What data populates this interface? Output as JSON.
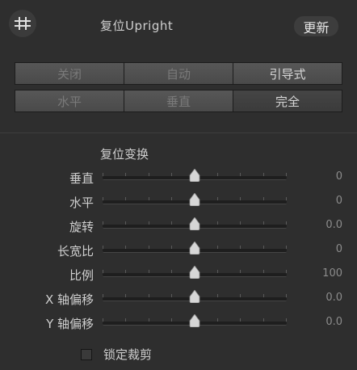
{
  "header": {
    "title": "复位Upright",
    "update_label": "更新",
    "tool_icon": "upright-grid-icon"
  },
  "mode_buttons": {
    "row1": [
      "关闭",
      "自动",
      "引导式"
    ],
    "row2": [
      "水平",
      "垂直",
      "完全"
    ]
  },
  "section": {
    "title": "复位变换"
  },
  "sliders": [
    {
      "label": "垂直",
      "value": "0",
      "position": 0.5
    },
    {
      "label": "水平",
      "value": "0",
      "position": 0.5
    },
    {
      "label": "旋转",
      "value": "0.0",
      "position": 0.5
    },
    {
      "label": "长宽比",
      "value": "0",
      "position": 0.5
    },
    {
      "label": "比例",
      "value": "100",
      "position": 0.5
    },
    {
      "label": "X 轴偏移",
      "value": "0.0",
      "position": 0.5
    },
    {
      "label": "Y 轴偏移",
      "value": "0.0",
      "position": 0.5
    }
  ],
  "lock_crop": {
    "label": "锁定裁剪",
    "checked": false
  },
  "colors": {
    "panel_bg": "#2e2e2e",
    "button_bg": "#505050",
    "text": "#cfcfcf"
  }
}
